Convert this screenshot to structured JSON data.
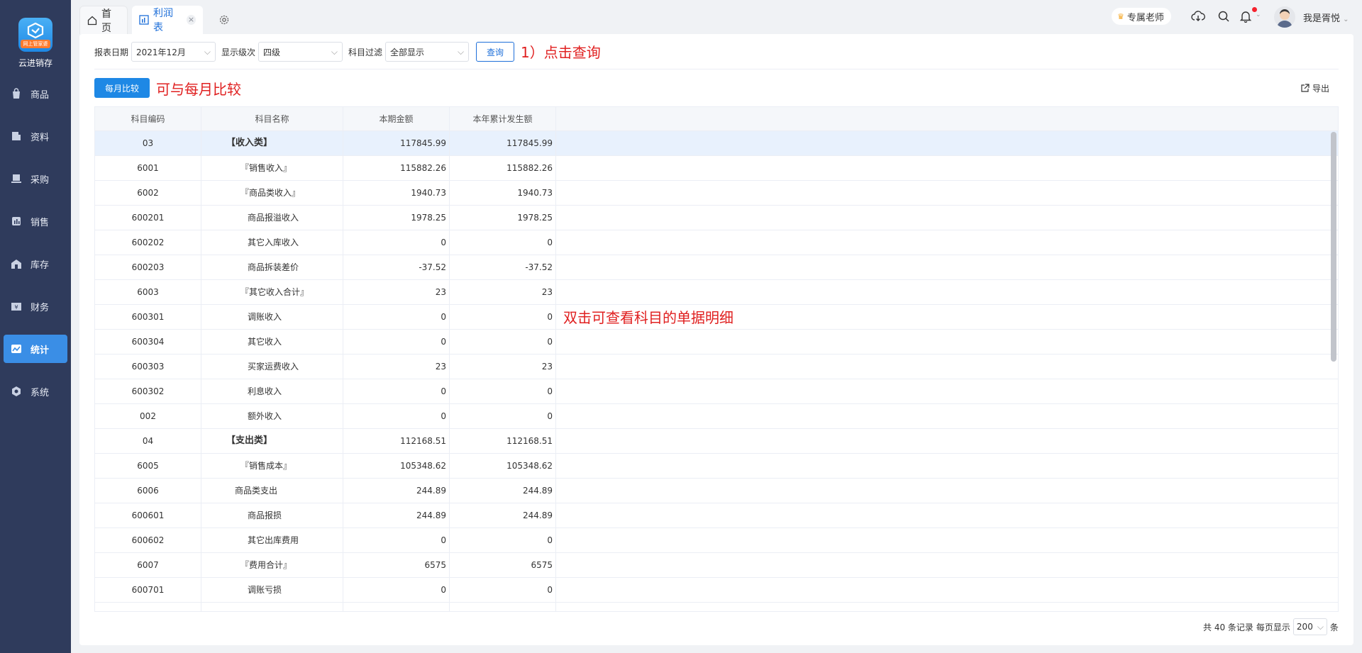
{
  "sidebar": {
    "logo_text": "网上管家婆",
    "app_name": "云进销存",
    "items": [
      {
        "label": "商品"
      },
      {
        "label": "资料"
      },
      {
        "label": "采购"
      },
      {
        "label": "销售"
      },
      {
        "label": "库存"
      },
      {
        "label": "财务"
      },
      {
        "label": "统计",
        "active": true
      },
      {
        "label": "系统"
      }
    ]
  },
  "topbar": {
    "tabs": [
      {
        "label": "首页"
      },
      {
        "label": "利润表",
        "active": true
      }
    ],
    "teacher_label": "专属老师",
    "username": "我是胥悦"
  },
  "filters": {
    "date_label": "报表日期",
    "date_value": "2021年12月",
    "level_label": "显示级次",
    "level_value": "四级",
    "subject_label": "科目过滤",
    "subject_value": "全部显示",
    "query_button": "查询"
  },
  "annotations": {
    "step1": "1）点击查询",
    "monthly": "可与每月比较",
    "detail": "双击可查看科目的单据明细"
  },
  "monthly_button": "每月比较",
  "export_label": "导出",
  "table": {
    "columns": [
      "科目编码",
      "科目名称",
      "本期金额",
      "本年累计发生额"
    ],
    "rows": [
      {
        "code": "03",
        "name": "【收入类】",
        "current": "117845.99",
        "ytd": "117845.99",
        "level": "l0"
      },
      {
        "code": "6001",
        "name": "『销售收入』",
        "current": "115882.26",
        "ytd": "115882.26",
        "level": "l1"
      },
      {
        "code": "6002",
        "name": "『商品类收入』",
        "current": "1940.73",
        "ytd": "1940.73",
        "level": "l1"
      },
      {
        "code": "600201",
        "name": "商品报溢收入",
        "current": "1978.25",
        "ytd": "1978.25",
        "level": "l2"
      },
      {
        "code": "600202",
        "name": "其它入库收入",
        "current": "0",
        "ytd": "0",
        "level": "l2"
      },
      {
        "code": "600203",
        "name": "商品拆装差价",
        "current": "-37.52",
        "ytd": "-37.52",
        "level": "l2"
      },
      {
        "code": "6003",
        "name": "『其它收入合计』",
        "current": "23",
        "ytd": "23",
        "level": "l1"
      },
      {
        "code": "600301",
        "name": "调账收入",
        "current": "0",
        "ytd": "0",
        "level": "l2"
      },
      {
        "code": "600304",
        "name": "其它收入",
        "current": "0",
        "ytd": "0",
        "level": "l2"
      },
      {
        "code": "600303",
        "name": "买家运费收入",
        "current": "23",
        "ytd": "23",
        "level": "l2"
      },
      {
        "code": "600302",
        "name": "利息收入",
        "current": "0",
        "ytd": "0",
        "level": "l2"
      },
      {
        "code": "002",
        "name": "额外收入",
        "current": "0",
        "ytd": "0",
        "level": "l2"
      },
      {
        "code": "04",
        "name": "【支出类】",
        "current": "112168.51",
        "ytd": "112168.51",
        "level": "l0"
      },
      {
        "code": "6005",
        "name": "『销售成本』",
        "current": "105348.62",
        "ytd": "105348.62",
        "level": "l1"
      },
      {
        "code": "6006",
        "name": "商品类支出",
        "current": "244.89",
        "ytd": "244.89",
        "level": "l1b"
      },
      {
        "code": "600601",
        "name": "商品报损",
        "current": "244.89",
        "ytd": "244.89",
        "level": "l2"
      },
      {
        "code": "600602",
        "name": "其它出库费用",
        "current": "0",
        "ytd": "0",
        "level": "l2"
      },
      {
        "code": "6007",
        "name": "『费用合计』",
        "current": "6575",
        "ytd": "6575",
        "level": "l1"
      },
      {
        "code": "600701",
        "name": "调账亏损",
        "current": "0",
        "ytd": "0",
        "level": "l2"
      },
      {
        "code": "",
        "name": "",
        "current": "",
        "ytd": "",
        "level": "l2"
      }
    ]
  },
  "pager": {
    "total_text": "共 40 条记录",
    "per_page_label": "每页显示",
    "per_page_value": "200",
    "unit": "条"
  },
  "colors": {
    "sidebar_bg": "#2f3b5c",
    "accent": "#1e88e5",
    "annotation": "#e02020"
  }
}
